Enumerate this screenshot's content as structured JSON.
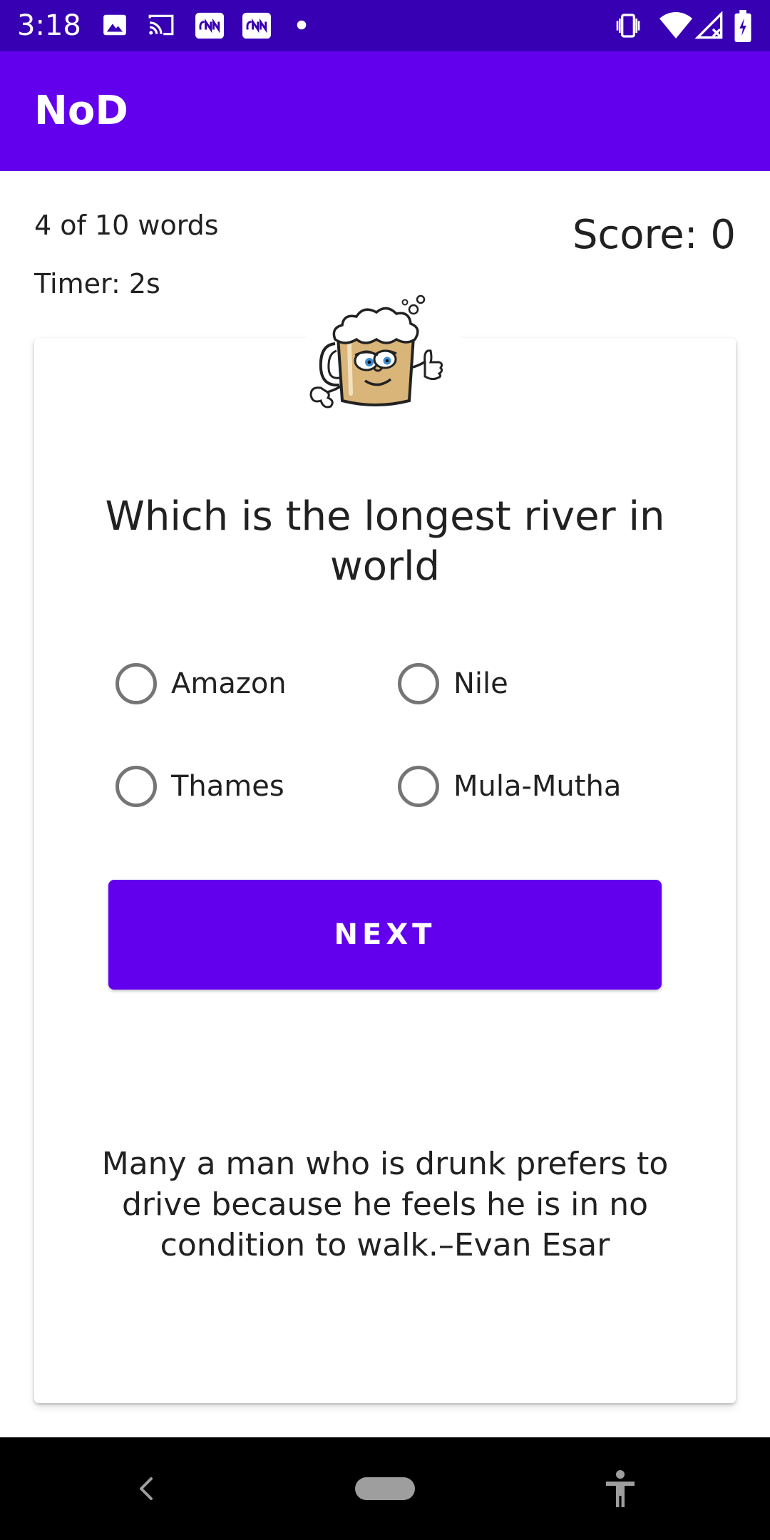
{
  "status_bar": {
    "time": "3:18"
  },
  "app_bar": {
    "title": "NoD"
  },
  "quiz": {
    "progress": "4 of 10 words",
    "timer": "Timer: 2s",
    "score": "Score: 0",
    "question": "Which is the longest river in world",
    "options": [
      "Amazon",
      "Nile",
      "Thames",
      "Mula-Mutha"
    ],
    "next_label": "NEXT",
    "quote": "Many a man who is drunk prefers to drive because he feels he is in no condition to walk.–Evan Esar"
  },
  "colors": {
    "primary": "#6200ee",
    "primary_dark": "#3700b3",
    "text": "#212121"
  }
}
